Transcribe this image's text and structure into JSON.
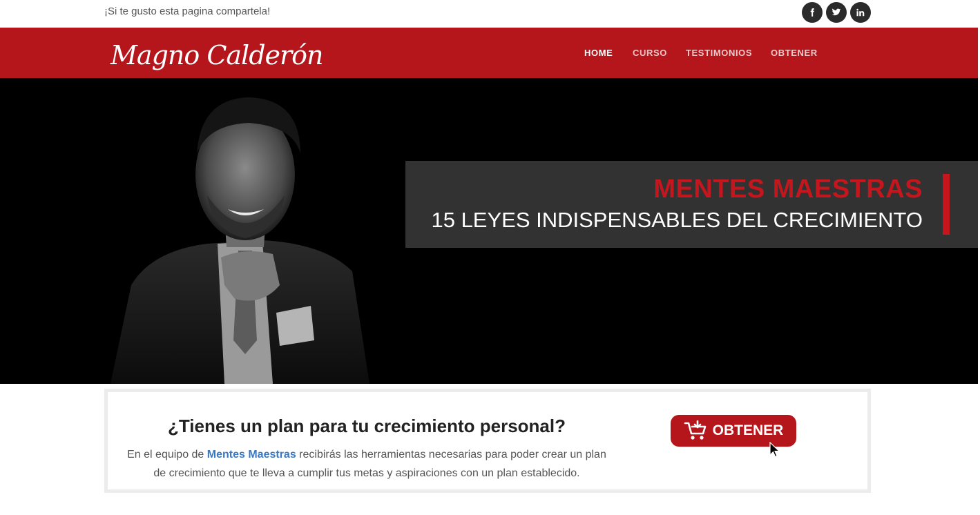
{
  "topbar": {
    "share_text": "¡Si te gusto esta pagina compartela!",
    "social": [
      {
        "icon": "facebook-icon"
      },
      {
        "icon": "twitter-icon"
      },
      {
        "icon": "linkedin-icon"
      }
    ]
  },
  "nav": {
    "logo_text": "Magno Calderón",
    "items": [
      {
        "label": "HOME",
        "active": true
      },
      {
        "label": "CURSO",
        "active": false
      },
      {
        "label": "TESTIMONIOS",
        "active": false
      },
      {
        "label": "OBTENER",
        "active": false
      }
    ]
  },
  "hero": {
    "title": "MENTES MAESTRAS",
    "subtitle": "15 LEYES INDISPENSABLES DEL CRECIMIENTO"
  },
  "card": {
    "title": "¿Tienes un plan para tu crecimiento personal?",
    "body_prefix": "En el equipo de ",
    "body_highlight": "Mentes Maestras",
    "body_suffix": " recibirás las herramientas necesarias para poder crear un plan de crecimiento que te lleva a cumplir tus metas y aspiraciones con un plan establecido.",
    "cta_label": "OBTENER",
    "cta_icon": "cart-icon"
  },
  "colors": {
    "brand_red": "#b5161c",
    "accent_red": "#c4161c",
    "banner_bg": "#323232",
    "link_blue": "#3a78c3"
  }
}
